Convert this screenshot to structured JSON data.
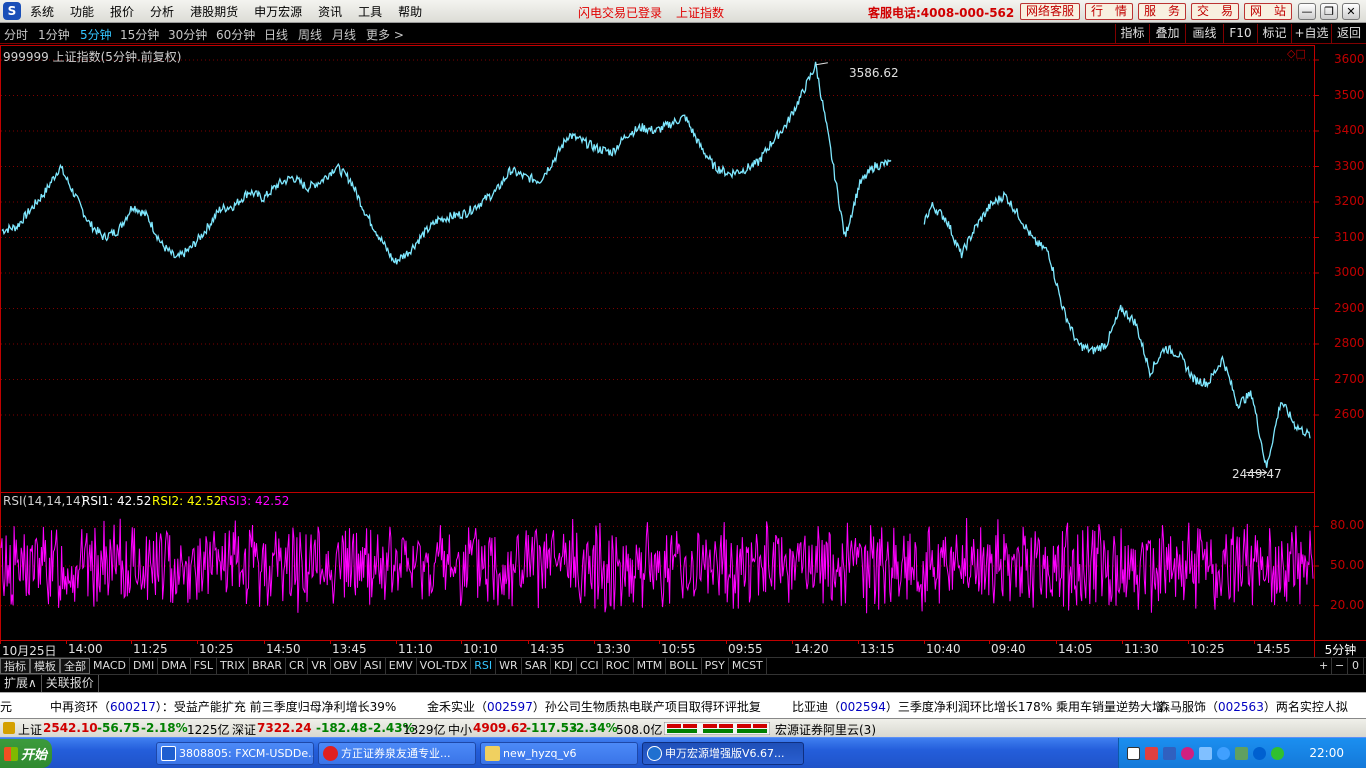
{
  "menubar": {
    "logo": "S",
    "items": [
      "系统",
      "功能",
      "报价",
      "分析",
      "港股期货",
      "申万宏源",
      "资讯",
      "工具",
      "帮助"
    ],
    "login_status": "闪电交易已登录",
    "index_name": "上证指数",
    "hotline": "客服电话:4008-000-562",
    "buttons": [
      "网络客服",
      "行　情",
      "服　务",
      "交　易",
      "网　站"
    ],
    "window_controls": [
      "—",
      "❐",
      "✕"
    ]
  },
  "periods": [
    "分时",
    "1分钟",
    "5分钟",
    "15分钟",
    "30分钟",
    "60分钟",
    "日线",
    "周线",
    "月线",
    "更多 >"
  ],
  "active_period": "5分钟",
  "right_tools": [
    "指标",
    "叠加",
    "画线",
    "F10",
    "标记",
    "+自选",
    "返回"
  ],
  "chart_header": {
    "title": "999999 上证指数(5分钟.前复权)",
    "corner_icons": "◇□"
  },
  "rsi_header": {
    "name": "RSI(14,14,14)",
    "rsi1": "RSI1: 42.52",
    "rsi2": "RSI2: 42.52",
    "rsi3": "RSI3: 42.52"
  },
  "annotations": {
    "high": "3586.62",
    "low": "2449.47"
  },
  "price_axis": [
    "3600",
    "3500",
    "3400",
    "3300",
    "3200",
    "3100",
    "3000",
    "2900",
    "2800",
    "2700",
    "2600"
  ],
  "rsi_axis": [
    "80.00",
    "50.00",
    "20.00"
  ],
  "dates": [
    "10月25日",
    "14:00",
    "11:25",
    "10:25",
    "14:50",
    "13:45",
    "11:10",
    "10:10",
    "14:35",
    "13:30",
    "10:55",
    "09:55",
    "14:20",
    "13:15",
    "10:40",
    "09:40",
    "14:05",
    "11:30",
    "10:25",
    "14:55"
  ],
  "period_indicator": "5分钟",
  "indicator_tabs": [
    "指标",
    "模板",
    "全部",
    "MACD",
    "DMI",
    "DMA",
    "FSL",
    "TRIX",
    "BRAR",
    "CR",
    "VR",
    "OBV",
    "ASI",
    "EMV",
    "VOL-TDX",
    "RSI",
    "WR",
    "SAR",
    "KDJ",
    "CCI",
    "ROC",
    "MTM",
    "BOLL",
    "PSY",
    "MCST"
  ],
  "active_indicator": "RSI",
  "panel_controls": [
    "+",
    "−",
    "0"
  ],
  "sub_tabs": [
    "扩展∧",
    "关联报价"
  ],
  "ticker": [
    {
      "prefix": "元",
      "code": "",
      "text": ""
    },
    {
      "prefix": "中再资环（",
      "code": "600217",
      "text": "）：受益产能扩充  前三季度归母净利增长39%"
    },
    {
      "prefix": "金禾实业（",
      "code": "002597",
      "text": "）孙公司生物质热电联产项目取得环评批复"
    },
    {
      "prefix": "比亚迪（",
      "code": "002594",
      "text": "）三季度净利润环比增长178%  乘用车销量逆势大增"
    },
    {
      "prefix": "森马服饰（",
      "code": "002563",
      "text": "）两名实控人拟"
    }
  ],
  "status": {
    "sh": {
      "label": "上证",
      "price": "2542.10",
      "change": "-56.75",
      "pct": "-2.18%",
      "vol": "1225亿"
    },
    "sz": {
      "label": "深证",
      "price": "7322.24",
      "change": "-182.48",
      "pct": "-2.43%",
      "vol": "1329亿"
    },
    "zx": {
      "label": "中小",
      "price": "4909.62",
      "change": "-117.53",
      "pct": "-2.34%",
      "vol": "508.0亿"
    },
    "server": "宏源证券阿里云(3)"
  },
  "taskbar": {
    "start": "开始",
    "tasks": [
      "3808805: FXCM-USDDe...",
      "方正证券泉友通专业...",
      "new_hyzq_v6",
      "申万宏源增强版V6.67..."
    ],
    "clock": "22:00"
  },
  "chart_data": {
    "type": "line",
    "instrument": "999999 上证指数",
    "interval": "5分钟",
    "adjustment": "前复权",
    "x_tick_labels": [
      "10月25日",
      "14:00",
      "11:25",
      "10:25",
      "14:50",
      "13:45",
      "11:10",
      "10:10",
      "14:35",
      "13:30",
      "10:55",
      "09:55",
      "14:20",
      "13:15",
      "10:40",
      "09:40",
      "14:05",
      "11:30",
      "10:25",
      "14:55"
    ],
    "approx_close_values": [
      3120,
      3130,
      3180,
      3230,
      3300,
      3220,
      3140,
      3100,
      3120,
      3190,
      3160,
      3080,
      3040,
      3070,
      3120,
      3180,
      3190,
      3230,
      3210,
      3250,
      3270,
      3240,
      3260,
      3300,
      3260,
      3170,
      3100,
      3030,
      3060,
      3110,
      3150,
      3160,
      3170,
      3200,
      3230,
      3290,
      3270,
      3260,
      3320,
      3390,
      3370,
      3350,
      3340,
      3390,
      3410,
      3400,
      3420,
      3440,
      3360,
      3300,
      3280,
      3290,
      3310,
      3370,
      3420,
      3500,
      3586.62,
      3350,
      3100,
      3250,
      3300,
      3310,
      3270,
      3110,
      3190,
      3150,
      3050,
      3130,
      3190,
      3220,
      3160,
      3090,
      3060,
      2900,
      2800,
      2780,
      2800,
      2900,
      2860,
      2720,
      2790,
      2770,
      2700,
      2690,
      2760,
      2630,
      2660,
      2449.47,
      2640,
      2570,
      2542.1
    ],
    "high": 3586.62,
    "low": 2449.47,
    "last": 2542.1,
    "ylim": [
      2400,
      3650
    ],
    "yticks": [
      2600,
      2700,
      2800,
      2900,
      3000,
      3100,
      3200,
      3300,
      3400,
      3500,
      3600
    ],
    "grid": true,
    "line_color": "#7fe8ff",
    "indicator": {
      "name": "RSI(14,14,14)",
      "rsi1": 42.52,
      "rsi2": 42.52,
      "rsi3": 42.52,
      "ylim": [
        0,
        100
      ],
      "yticks": [
        20,
        50,
        80
      ],
      "color": "#ff00ff"
    }
  },
  "colors": {
    "axis_red": "#c00000",
    "grid": "#800000",
    "price_line": "#7fe8ff",
    "rsi": "#ff00ff",
    "active_blue": "#34c6ff"
  }
}
